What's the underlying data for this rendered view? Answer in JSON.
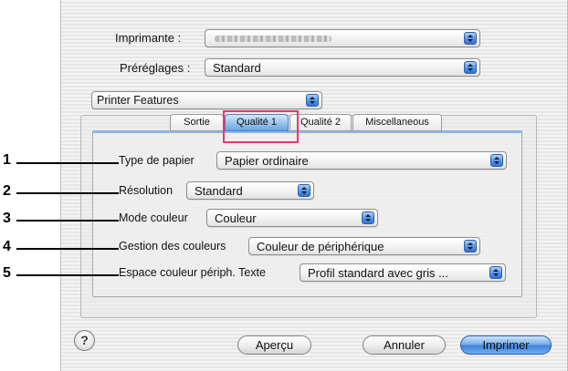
{
  "printer": {
    "label": "Imprimante :",
    "value": ""
  },
  "presets": {
    "label": "Préréglages :",
    "value": "Standard"
  },
  "panel_selector": {
    "value": "Printer Features"
  },
  "tabs": [
    {
      "label": "Sortie"
    },
    {
      "label": "Qualité 1"
    },
    {
      "label": "Qualité 2"
    },
    {
      "label": "Miscellaneous"
    }
  ],
  "settings": [
    {
      "callout": "1",
      "label": "Type de papier",
      "value": "Papier ordinaire"
    },
    {
      "callout": "2",
      "label": "Résolution",
      "value": "Standard"
    },
    {
      "callout": "3",
      "label": "Mode couleur",
      "value": "Couleur"
    },
    {
      "callout": "4",
      "label": "Gestion des couleurs",
      "value": "Couleur de périphérique"
    },
    {
      "callout": "5",
      "label": "Espace couleur périph. Texte",
      "value": "Profil standard avec gris ..."
    }
  ],
  "help": {
    "label": "?"
  },
  "buttons": {
    "preview": "Aperçu",
    "cancel": "Annuler",
    "print": "Imprimer"
  },
  "colors": {
    "accent_blue": "#3f83d8",
    "highlight": "#e8386d"
  }
}
